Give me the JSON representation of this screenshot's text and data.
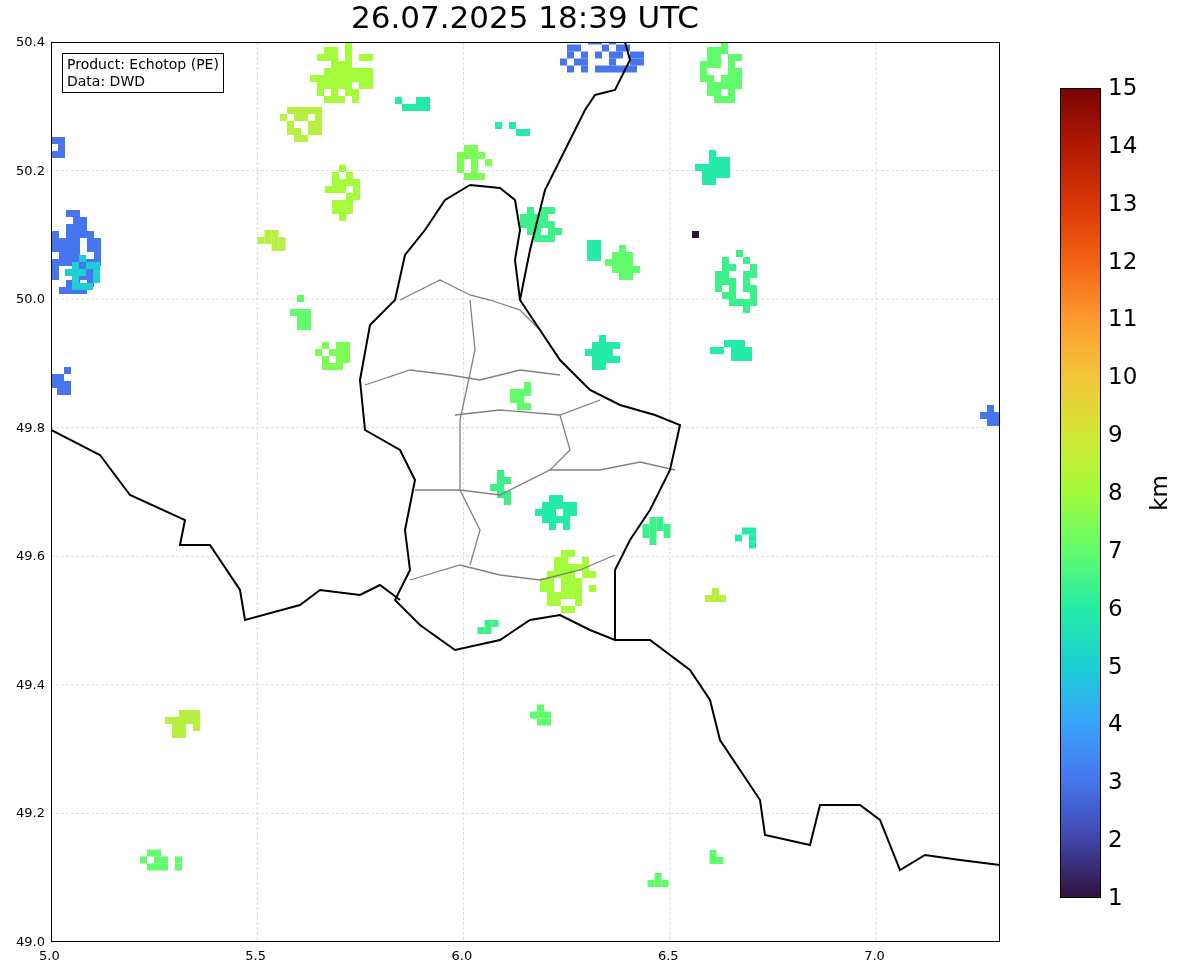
{
  "title": "26.07.2025 18:39 UTC",
  "info_box": [
    "Product: Echotop (PE)",
    "Data: DWD"
  ],
  "map": {
    "xticks": [
      "5.0",
      "5.5",
      "6.0",
      "6.5",
      "7.0"
    ],
    "yticks": [
      "50.4",
      "50.2",
      "50.0",
      "49.8",
      "49.6",
      "49.4",
      "49.2",
      "49.0"
    ]
  },
  "colorbar": {
    "label": "km",
    "ticks": [
      "15",
      "14",
      "13",
      "12",
      "11",
      "10",
      "9",
      "8",
      "7",
      "6",
      "5",
      "4",
      "3",
      "2",
      "1"
    ]
  }
}
